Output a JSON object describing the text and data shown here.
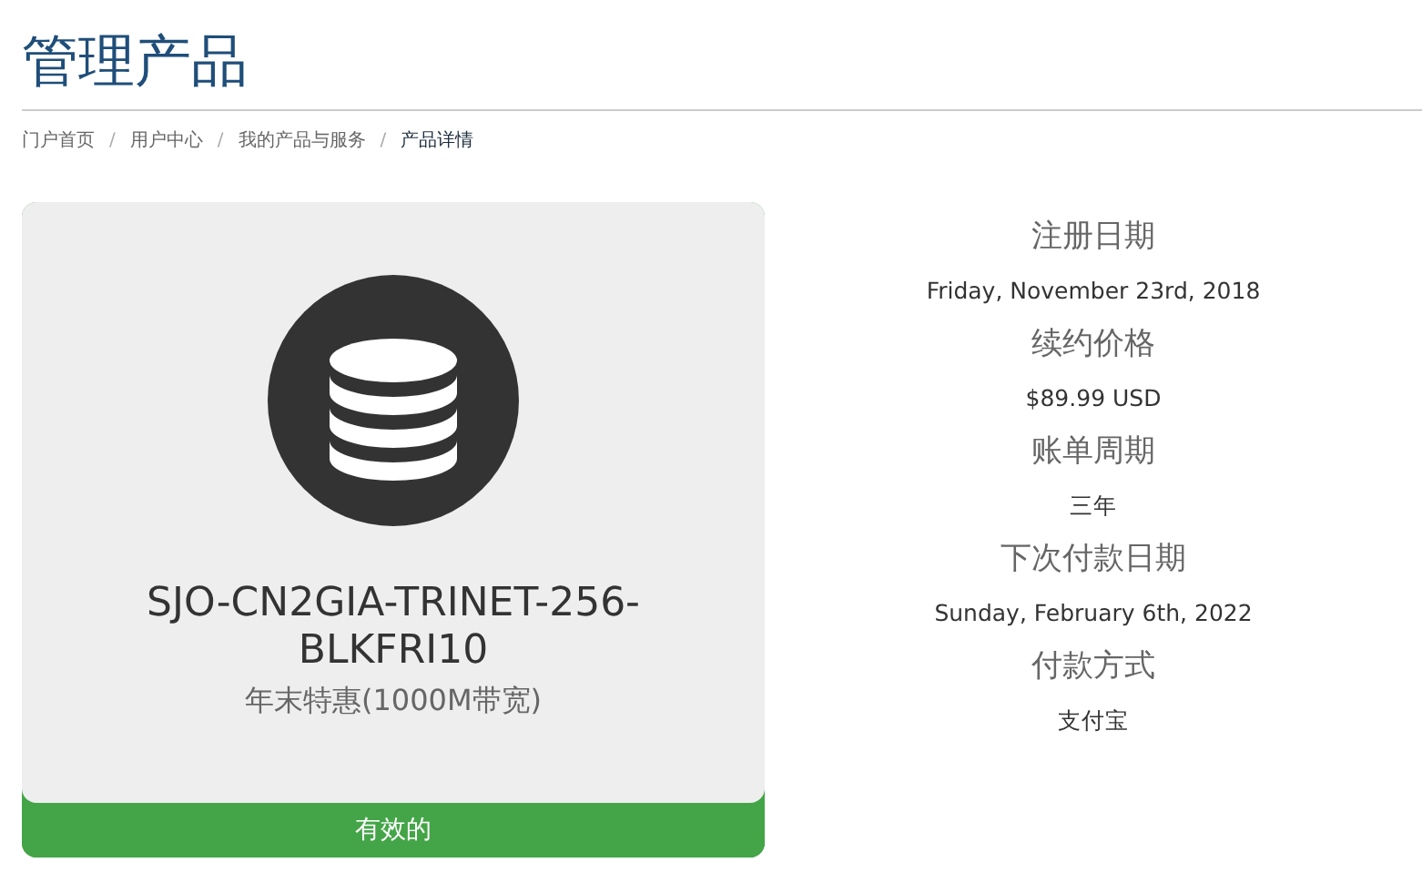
{
  "page_title": "管理产品",
  "breadcrumb": [
    {
      "label": "门户首页",
      "selected": false
    },
    {
      "label": "用户中心",
      "selected": false
    },
    {
      "label": "我的产品与服务",
      "selected": false
    },
    {
      "label": "产品详情",
      "selected": true
    }
  ],
  "breadcrumb_separator": "/",
  "product": {
    "name": "SJO-CN2GIA-TRINET-256-BLKFRI10",
    "group": "年末特惠(1000M带宽)",
    "status": {
      "label": "有效的",
      "kind": "active"
    }
  },
  "details": [
    {
      "label": "注册日期",
      "value": "Friday, November 23rd, 2018"
    },
    {
      "label": "续约价格",
      "value": "$89.99 USD"
    },
    {
      "label": "账单周期",
      "value": "三年"
    },
    {
      "label": "下次付款日期",
      "value": "Sunday, February 6th, 2022"
    },
    {
      "label": "付款方式",
      "value": "支付宝"
    }
  ]
}
